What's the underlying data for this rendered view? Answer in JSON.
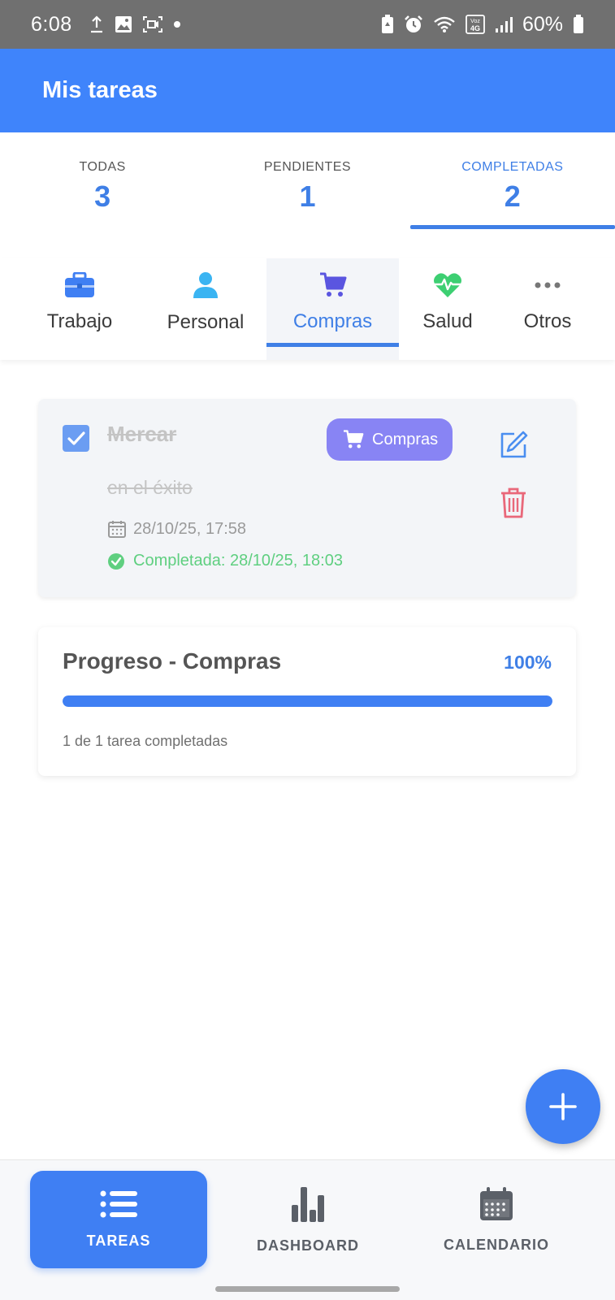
{
  "status_bar": {
    "time": "6:08",
    "battery": "60%",
    "left_icons": [
      "upload-icon",
      "image-icon",
      "screen-record-icon",
      "dot-icon"
    ],
    "right_icons": [
      "battery-saver-icon",
      "alarm-icon",
      "wifi-icon",
      "volte-4g-icon",
      "signal-icon",
      "battery-icon"
    ]
  },
  "app_bar": {
    "title": "Mis tareas",
    "color": "#3f84fb"
  },
  "filters": [
    {
      "label": "TODAS",
      "count": "3",
      "active": false
    },
    {
      "label": "PENDIENTES",
      "count": "1",
      "active": false
    },
    {
      "label": "COMPLETADAS",
      "count": "2",
      "active": true
    }
  ],
  "categories": [
    {
      "label": "Trabajo",
      "icon": "briefcase-icon",
      "color": "#3f7ff3",
      "active": false
    },
    {
      "label": "Personal",
      "icon": "person-icon",
      "color": "#3ab4f2",
      "active": false
    },
    {
      "label": "Compras",
      "icon": "cart-icon",
      "color": "#5a55e0",
      "active": true
    },
    {
      "label": "Salud",
      "icon": "heart-pulse-icon",
      "color": "#3dcf72",
      "active": false
    },
    {
      "label": "Otros",
      "icon": "more-icon",
      "color": "#777777",
      "active": false
    }
  ],
  "task": {
    "title": "Mercar",
    "description": "en el éxito",
    "category_badge": "Compras",
    "badge_color": "#8884f4",
    "created": "28/10/25, 17:58",
    "completed": "Completada: 28/10/25, 18:03",
    "checked": true
  },
  "progress": {
    "title": "Progreso - Compras",
    "percent": "100%",
    "value": 1.0,
    "summary": "1 de 1 tarea completadas"
  },
  "bottom_nav": [
    {
      "label": "TAREAS",
      "icon": "list-icon",
      "active": true
    },
    {
      "label": "DASHBOARD",
      "icon": "bar-chart-icon",
      "active": false
    },
    {
      "label": "CALENDARIO",
      "icon": "calendar-icon",
      "active": false
    }
  ]
}
